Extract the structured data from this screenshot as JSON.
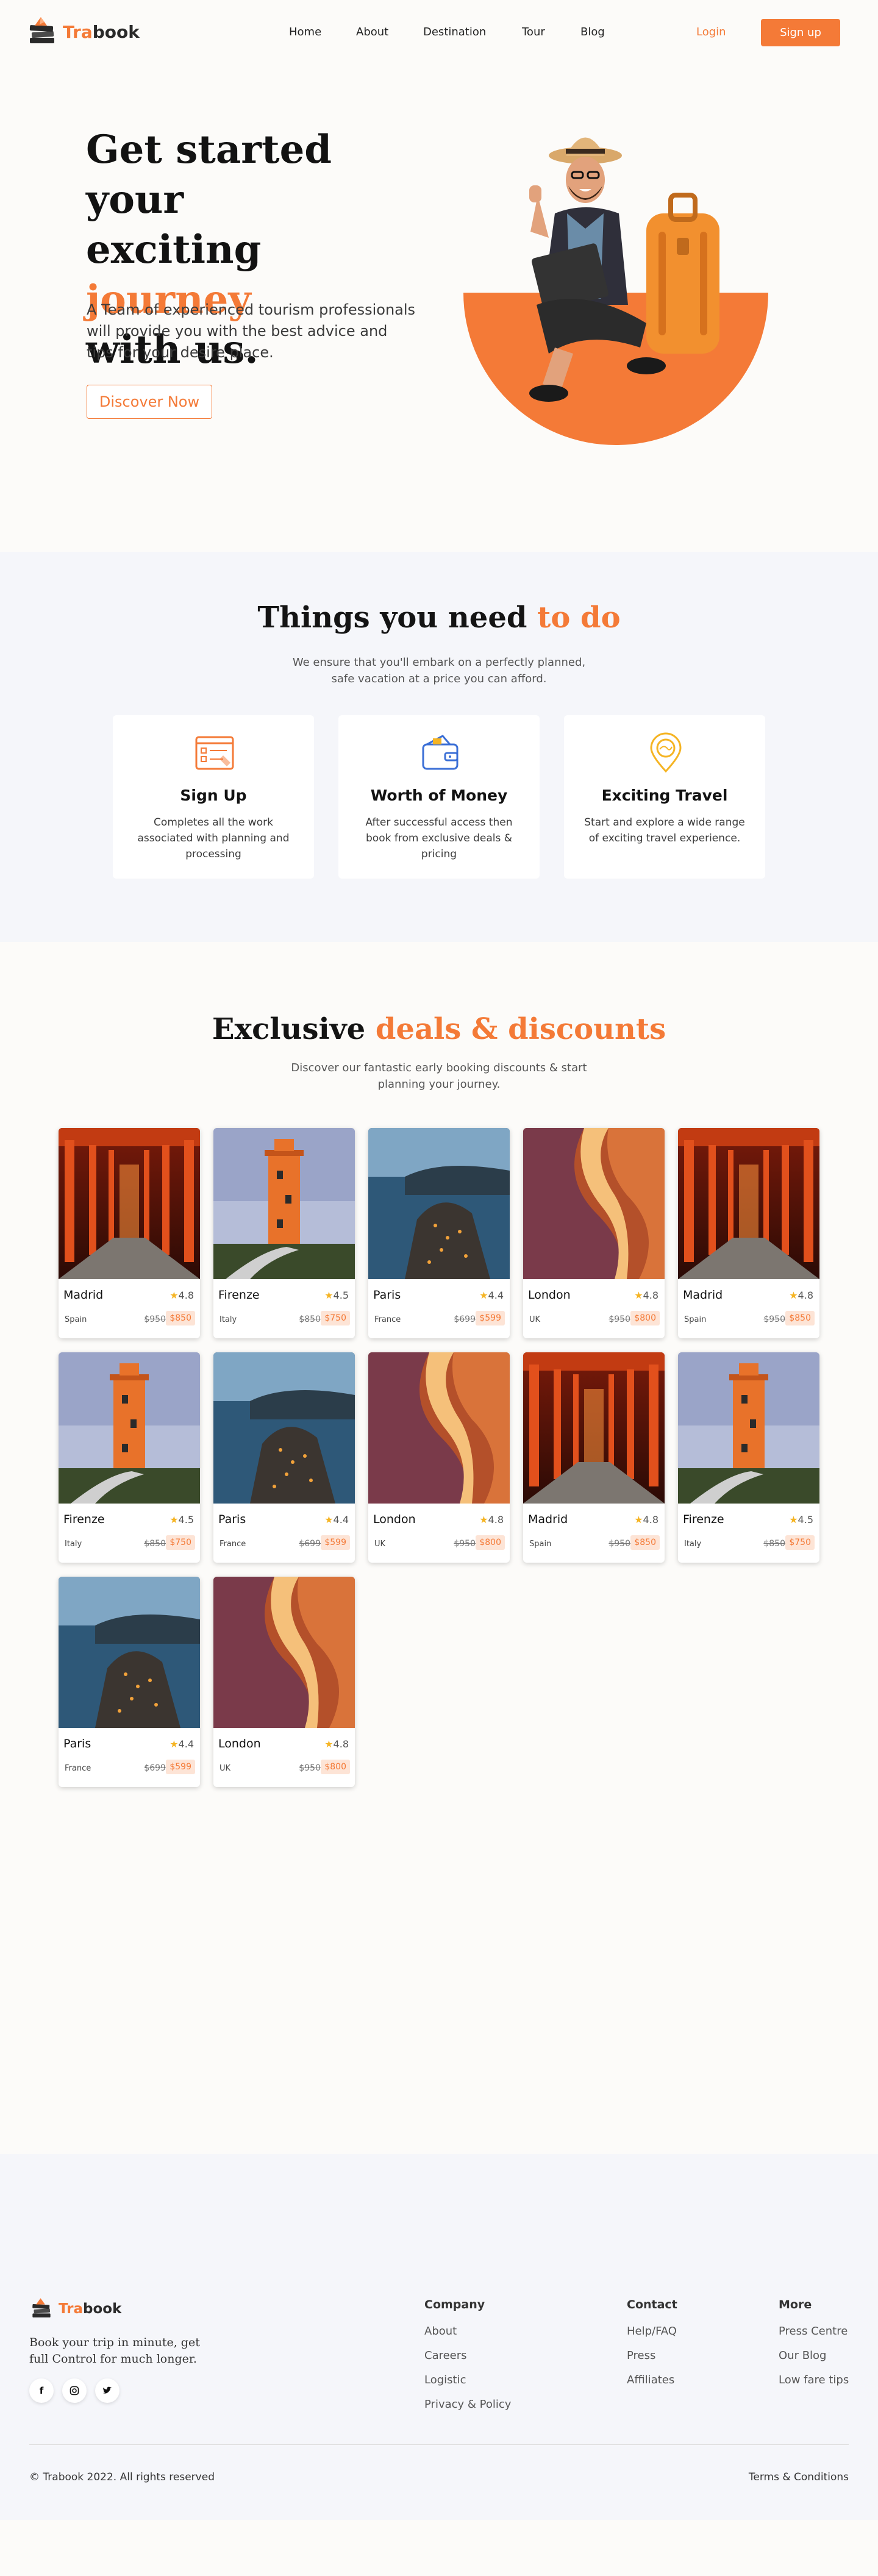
{
  "brand": {
    "logo_prefix": "Tra",
    "logo_suffix": "book"
  },
  "nav": {
    "links": [
      "Home",
      "About",
      "Destination",
      "Tour",
      "Blog"
    ],
    "login": "Login",
    "signup": "Sign up"
  },
  "hero": {
    "title_line1": "Get started your",
    "title_line2a": "exciting ",
    "title_line2b": "journey",
    "title_line3": "with us.",
    "description": "A Team of experienced tourism professionals will provide you with the best advice and tips for your desire place.",
    "cta": "Discover Now"
  },
  "things": {
    "title_a": "Things you need ",
    "title_b": "to do",
    "subtitle": "We ensure that you'll embark on a perfectly planned, safe vacation at a price you can afford.",
    "cards": [
      {
        "icon": "form-icon",
        "title": "Sign Up",
        "text": "Completes all the work associated with planning and processing"
      },
      {
        "icon": "wallet-icon",
        "title": "Worth of Money",
        "text": "After successful access then book from exclusive deals & pricing"
      },
      {
        "icon": "map-pin-icon",
        "title": "Exciting Travel",
        "text": "Start and explore a wide range of exciting travel experience."
      }
    ]
  },
  "deals": {
    "title_a": "Exclusive ",
    "title_b": "deals & discounts",
    "subtitle": "Discover our fantastic early booking discounts & start planning your journey.",
    "items": [
      {
        "image": "torii",
        "city": "Madrid",
        "rating": "4.8",
        "country": "Spain",
        "old_price": "$950",
        "new_price": "$850"
      },
      {
        "image": "lighthouse",
        "city": "Firenze",
        "rating": "4.5",
        "country": "Italy",
        "old_price": "$850",
        "new_price": "$750"
      },
      {
        "image": "cliff",
        "city": "Paris",
        "rating": "4.4",
        "country": "France",
        "old_price": "$699",
        "new_price": "$599"
      },
      {
        "image": "canyon",
        "city": "London",
        "rating": "4.8",
        "country": "UK",
        "old_price": "$950",
        "new_price": "$800"
      },
      {
        "image": "torii",
        "city": "Madrid",
        "rating": "4.8",
        "country": "Spain",
        "old_price": "$950",
        "new_price": "$850"
      },
      {
        "image": "lighthouse",
        "city": "Firenze",
        "rating": "4.5",
        "country": "Italy",
        "old_price": "$850",
        "new_price": "$750"
      },
      {
        "image": "cliff",
        "city": "Paris",
        "rating": "4.4",
        "country": "France",
        "old_price": "$699",
        "new_price": "$599"
      },
      {
        "image": "canyon",
        "city": "London",
        "rating": "4.8",
        "country": "UK",
        "old_price": "$950",
        "new_price": "$800"
      },
      {
        "image": "torii",
        "city": "Madrid",
        "rating": "4.8",
        "country": "Spain",
        "old_price": "$950",
        "new_price": "$850"
      },
      {
        "image": "lighthouse",
        "city": "Firenze",
        "rating": "4.5",
        "country": "Italy",
        "old_price": "$850",
        "new_price": "$750"
      },
      {
        "image": "cliff",
        "city": "Paris",
        "rating": "4.4",
        "country": "France",
        "old_price": "$699",
        "new_price": "$599"
      },
      {
        "image": "canyon",
        "city": "London",
        "rating": "4.8",
        "country": "UK",
        "old_price": "$950",
        "new_price": "$800"
      }
    ]
  },
  "footer": {
    "tagline": "Book your trip in minute, get full Control for much longer.",
    "socials": [
      "facebook-icon",
      "instagram-icon",
      "twitter-icon"
    ],
    "columns": [
      {
        "title": "Company",
        "links": [
          "About",
          "Careers",
          "Logistic",
          "Privacy & Policy"
        ]
      },
      {
        "title": "Contact",
        "links": [
          "Help/FAQ",
          "Press",
          "Affiliates"
        ]
      },
      {
        "title": "More",
        "links": [
          "Press Centre",
          "Our Blog",
          "Low fare tips"
        ]
      }
    ],
    "copyright": "© Trabook 2022. All rights reserved",
    "terms": "Terms & Conditions"
  },
  "colors": {
    "accent": "#f47a37",
    "section_bg": "#f5f6fa",
    "page_bg": "#fcfbf9",
    "star": "#f5b423"
  }
}
